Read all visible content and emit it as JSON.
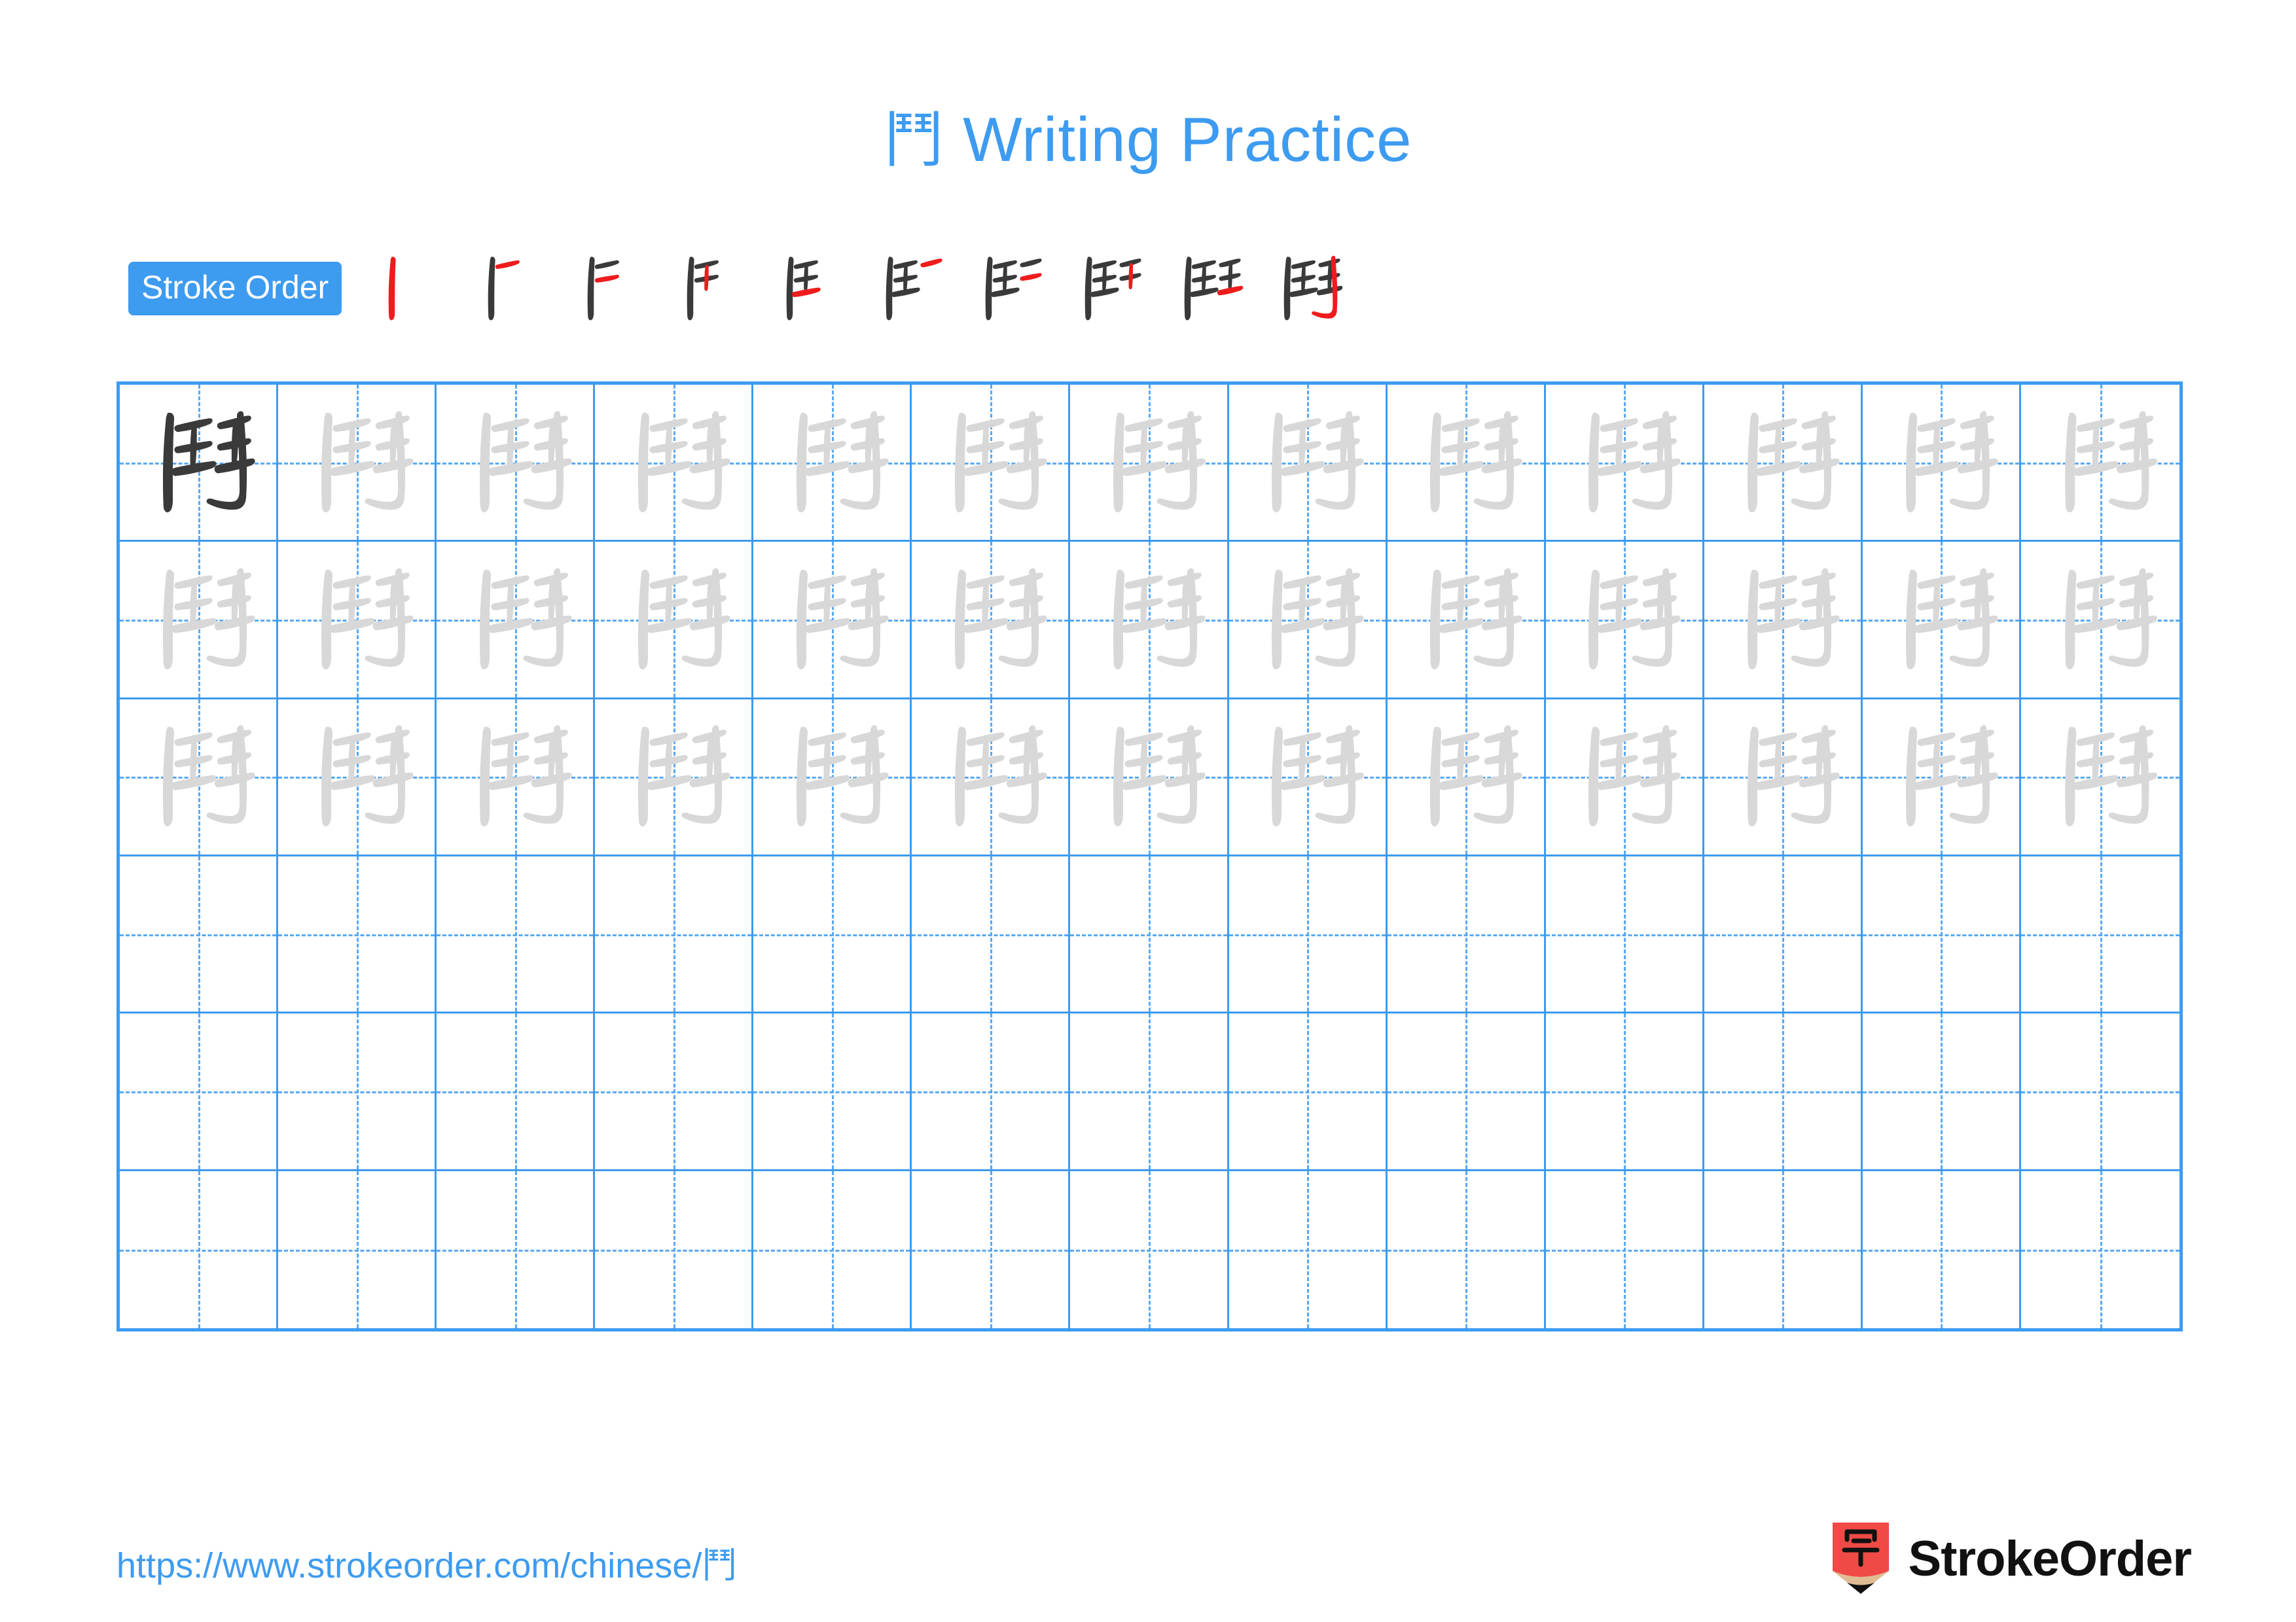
{
  "character": "鬥",
  "header": {
    "title_character": "鬥",
    "title_text": " Writing Practice",
    "title_full": "鬥 Writing Practice",
    "title_color": "#3d9bf0"
  },
  "stroke_order": {
    "label": "Stroke Order",
    "label_bg_color": "#3d9bf0",
    "label_text_color": "#ffffff",
    "total_strokes": 10,
    "new_stroke_color": "#ee1c1c",
    "done_stroke_color": "#3a3a3a",
    "steps": [
      {
        "index": 1,
        "name": "stroke-step-1",
        "strokes_shown": 1
      },
      {
        "index": 2,
        "name": "stroke-step-2",
        "strokes_shown": 2
      },
      {
        "index": 3,
        "name": "stroke-step-3",
        "strokes_shown": 3
      },
      {
        "index": 4,
        "name": "stroke-step-4",
        "strokes_shown": 4
      },
      {
        "index": 5,
        "name": "stroke-step-5",
        "strokes_shown": 5
      },
      {
        "index": 6,
        "name": "stroke-step-6",
        "strokes_shown": 6
      },
      {
        "index": 7,
        "name": "stroke-step-7",
        "strokes_shown": 7
      },
      {
        "index": 8,
        "name": "stroke-step-8",
        "strokes_shown": 8
      },
      {
        "index": 9,
        "name": "stroke-step-9",
        "strokes_shown": 9
      },
      {
        "index": 10,
        "name": "stroke-step-10",
        "strokes_shown": 10
      }
    ]
  },
  "practice_grid": {
    "columns": 13,
    "rows": 6,
    "grid_line_color": "#3d9bf0",
    "guide_line_color": "#5aa8f2",
    "model_glyph_color": "#3a3a3a",
    "trace_glyph_color": "#d8d8d8",
    "cells": [
      [
        "model",
        "trace",
        "trace",
        "trace",
        "trace",
        "trace",
        "trace",
        "trace",
        "trace",
        "trace",
        "trace",
        "trace",
        "trace"
      ],
      [
        "trace",
        "trace",
        "trace",
        "trace",
        "trace",
        "trace",
        "trace",
        "trace",
        "trace",
        "trace",
        "trace",
        "trace",
        "trace"
      ],
      [
        "trace",
        "trace",
        "trace",
        "trace",
        "trace",
        "trace",
        "trace",
        "trace",
        "trace",
        "trace",
        "trace",
        "trace",
        "trace"
      ],
      [
        "empty",
        "empty",
        "empty",
        "empty",
        "empty",
        "empty",
        "empty",
        "empty",
        "empty",
        "empty",
        "empty",
        "empty",
        "empty"
      ],
      [
        "empty",
        "empty",
        "empty",
        "empty",
        "empty",
        "empty",
        "empty",
        "empty",
        "empty",
        "empty",
        "empty",
        "empty",
        "empty"
      ],
      [
        "empty",
        "empty",
        "empty",
        "empty",
        "empty",
        "empty",
        "empty",
        "empty",
        "empty",
        "empty",
        "empty",
        "empty",
        "empty"
      ]
    ]
  },
  "footer": {
    "url_prefix": "https://www.strokeorder.com/chinese/",
    "url_character": "鬥",
    "url_full": "https://www.strokeorder.com/chinese/鬥",
    "url_color": "#3d9bf0",
    "brand_name": "StrokeOrder",
    "brand_mark_character": "字",
    "brand_mark_body_color": "#f04a46",
    "brand_mark_wood_color": "#e0bc94",
    "brand_mark_tip_color": "#111111"
  }
}
